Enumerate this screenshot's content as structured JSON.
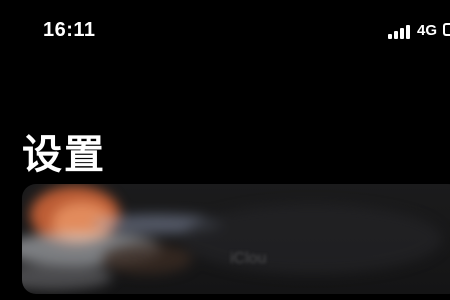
{
  "status_bar": {
    "time": "16:11",
    "network": "4G",
    "icons": [
      "signal-icon",
      "battery-icon"
    ]
  },
  "header": {
    "title": "设置"
  },
  "profile_card": {
    "blurred_text": "iClou"
  },
  "colors": {
    "background": "#000000",
    "text": "#ffffff",
    "card": "#1b1b1c",
    "avatar_accent": "#e0703e"
  }
}
